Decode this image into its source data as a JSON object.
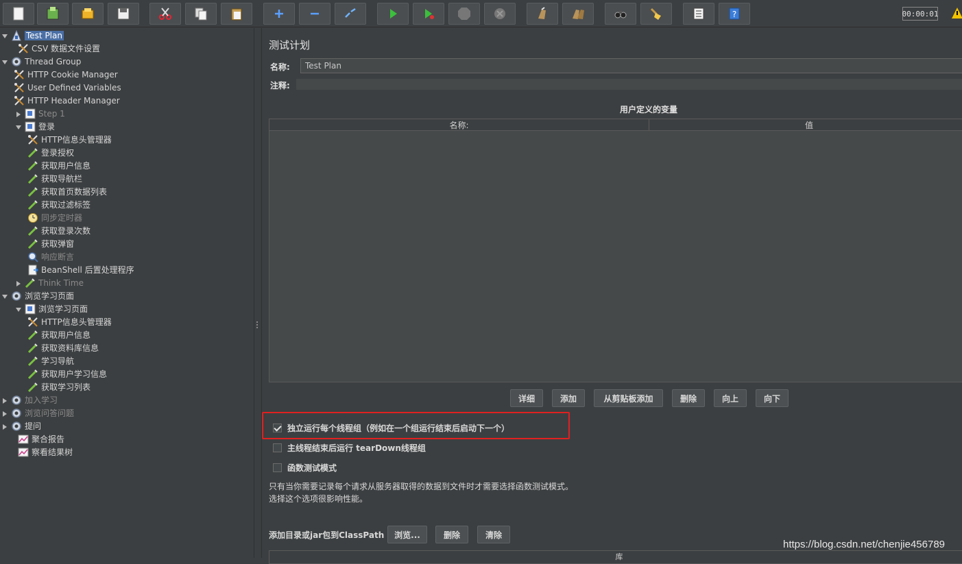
{
  "toolbar": {
    "buttons": [
      "new-icon",
      "templates-icon",
      "open-icon",
      "save-icon",
      "cut-icon",
      "copy-icon",
      "paste-icon",
      "expand-icon",
      "collapse-icon",
      "toggle-icon",
      "start-icon",
      "start-no-pause-icon",
      "stop-icon",
      "shutdown-icon",
      "clear-icon",
      "clear-all-icon",
      "search-icon",
      "reset-search-icon",
      "function-helper-icon",
      "help-icon"
    ],
    "timer": "00:00:01"
  },
  "tree": {
    "items": [
      {
        "label": "Test Plan",
        "icon": "test-plan-icon",
        "indent": 0,
        "arrow": "down",
        "selected": true
      },
      {
        "label": "CSV 数据文件设置",
        "icon": "config-icon",
        "indent": 1
      },
      {
        "label": "Thread Group",
        "icon": "gear-icon",
        "indent": 0,
        "arrow": "down"
      },
      {
        "label": "HTTP Cookie Manager",
        "icon": "config-icon",
        "indent": 2
      },
      {
        "label": "User Defined Variables",
        "icon": "config-icon",
        "indent": 2
      },
      {
        "label": "HTTP Header Manager",
        "icon": "config-icon",
        "indent": 2
      },
      {
        "label": "Step 1",
        "icon": "controller-icon",
        "indent": 1,
        "arrow": "right",
        "disabled": true
      },
      {
        "label": "登录",
        "icon": "controller-icon",
        "indent": 1,
        "arrow": "down"
      },
      {
        "label": "HTTP信息头管理器",
        "icon": "config-icon",
        "indent": 3
      },
      {
        "label": "登录授权",
        "icon": "sampler-icon",
        "indent": 3
      },
      {
        "label": "获取用户信息",
        "icon": "sampler-icon",
        "indent": 3
      },
      {
        "label": "获取导航栏",
        "icon": "sampler-icon",
        "indent": 3
      },
      {
        "label": "获取首页数据列表",
        "icon": "sampler-icon",
        "indent": 3
      },
      {
        "label": "获取过滤标签",
        "icon": "sampler-icon",
        "indent": 3
      },
      {
        "label": "同步定时器",
        "icon": "timer-icon",
        "indent": 3,
        "disabled": true
      },
      {
        "label": "获取登录次数",
        "icon": "sampler-icon",
        "indent": 3
      },
      {
        "label": "获取弹窗",
        "icon": "sampler-icon",
        "indent": 3
      },
      {
        "label": "响应断言",
        "icon": "assertion-icon",
        "indent": 3,
        "disabled": true
      },
      {
        "label": "BeanShell 后置处理程序",
        "icon": "postprocessor-icon",
        "indent": 3
      },
      {
        "label": "Think Time",
        "icon": "sampler-icon",
        "indent": 1,
        "arrow": "right",
        "disabled": true
      },
      {
        "label": "浏览学习页面",
        "icon": "gear-icon",
        "indent": 0,
        "arrow": "down"
      },
      {
        "label": "浏览学习页面",
        "icon": "controller-icon",
        "indent": 1,
        "arrow": "down"
      },
      {
        "label": "HTTP信息头管理器",
        "icon": "config-icon",
        "indent": 3
      },
      {
        "label": "获取用户信息",
        "icon": "sampler-icon",
        "indent": 3
      },
      {
        "label": "获取资料库信息",
        "icon": "sampler-icon",
        "indent": 3
      },
      {
        "label": "学习导航",
        "icon": "sampler-icon",
        "indent": 3
      },
      {
        "label": "获取用户学习信息",
        "icon": "sampler-icon",
        "indent": 3
      },
      {
        "label": "获取学习列表",
        "icon": "sampler-icon",
        "indent": 3
      },
      {
        "label": "加入学习",
        "icon": "gear-icon",
        "indent": 0,
        "arrow": "right",
        "disabled": true
      },
      {
        "label": "浏览问答问题",
        "icon": "gear-icon",
        "indent": 0,
        "arrow": "right",
        "disabled": true
      },
      {
        "label": "提问",
        "icon": "gear-icon",
        "indent": 0,
        "arrow": "right"
      },
      {
        "label": "聚合报告",
        "icon": "listener-icon",
        "indent": 1
      },
      {
        "label": "察看结果树",
        "icon": "listener-icon",
        "indent": 1
      }
    ]
  },
  "panel": {
    "title": "测试计划",
    "name_label": "名称:",
    "name_value": "Test Plan",
    "comment_label": "注释:",
    "vars_title": "用户定义的变量",
    "vars_columns": [
      "名称:",
      "值"
    ],
    "buttons": [
      "详细",
      "添加",
      "从剪贴板添加",
      "删除",
      "向上",
      "向下"
    ],
    "checkboxes": [
      {
        "label": "独立运行每个线程组（例如在一个组运行结束后启动下一个）",
        "checked": true
      },
      {
        "label": "主线程结束后运行 tearDown线程组",
        "checked": false
      },
      {
        "label": "函数测试模式",
        "checked": false
      }
    ],
    "note_line1": "只有当你需要记录每个请求从服务器取得的数据到文件时才需要选择函数测试模式。",
    "note_line2": "选择这个选项很影响性能。",
    "classpath_label": "添加目录或jar包到ClassPath",
    "classpath_buttons": [
      "浏览...",
      "删除",
      "清除"
    ],
    "lib_column": "库"
  },
  "watermark": "https://blog.csdn.net/chenjie456789",
  "colors": {
    "highlight": "#e02020",
    "selection": "#4a6fa5",
    "background": "#3c3f41"
  }
}
